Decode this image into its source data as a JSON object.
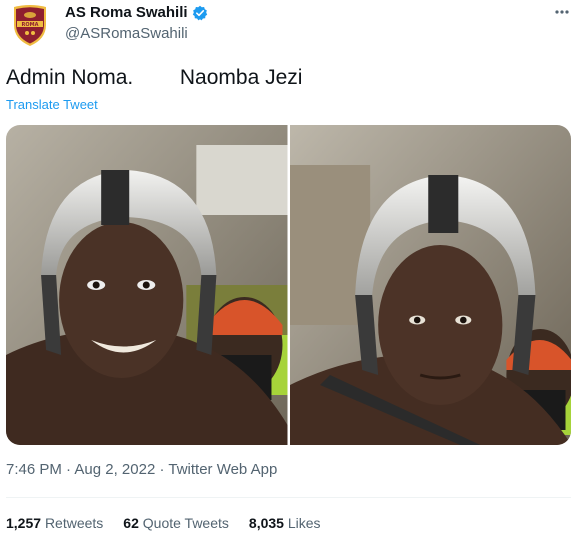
{
  "author": {
    "display_name": "AS Roma Swahili",
    "handle": "@ASRomaSwahili",
    "avatar_icon": "as-roma-crest-icon",
    "verified_icon": "verified-badge-icon"
  },
  "more_icon": "more-options-icon",
  "tweet": {
    "text": "Admin Noma.        Naomba Jezi",
    "translate_label": "Translate Tweet"
  },
  "media": {
    "photos": [
      {
        "icon": "photo-rider-smiling"
      },
      {
        "icon": "photo-rider-serious"
      }
    ]
  },
  "meta": {
    "time": "7:46 PM",
    "separator": " · ",
    "date": "Aug 2, 2022",
    "source": "Twitter Web App"
  },
  "stats": {
    "retweets_count": "1,257",
    "retweets_label": "Retweets",
    "quotes_count": "62",
    "quotes_label": "Quote Tweets",
    "likes_count": "8,035",
    "likes_label": "Likes"
  },
  "colors": {
    "link": "#1d9bf0",
    "secondary_text": "#536471",
    "primary_text": "#0f1419",
    "roma_red": "#8e1f2f",
    "roma_gold": "#f0bc42"
  }
}
